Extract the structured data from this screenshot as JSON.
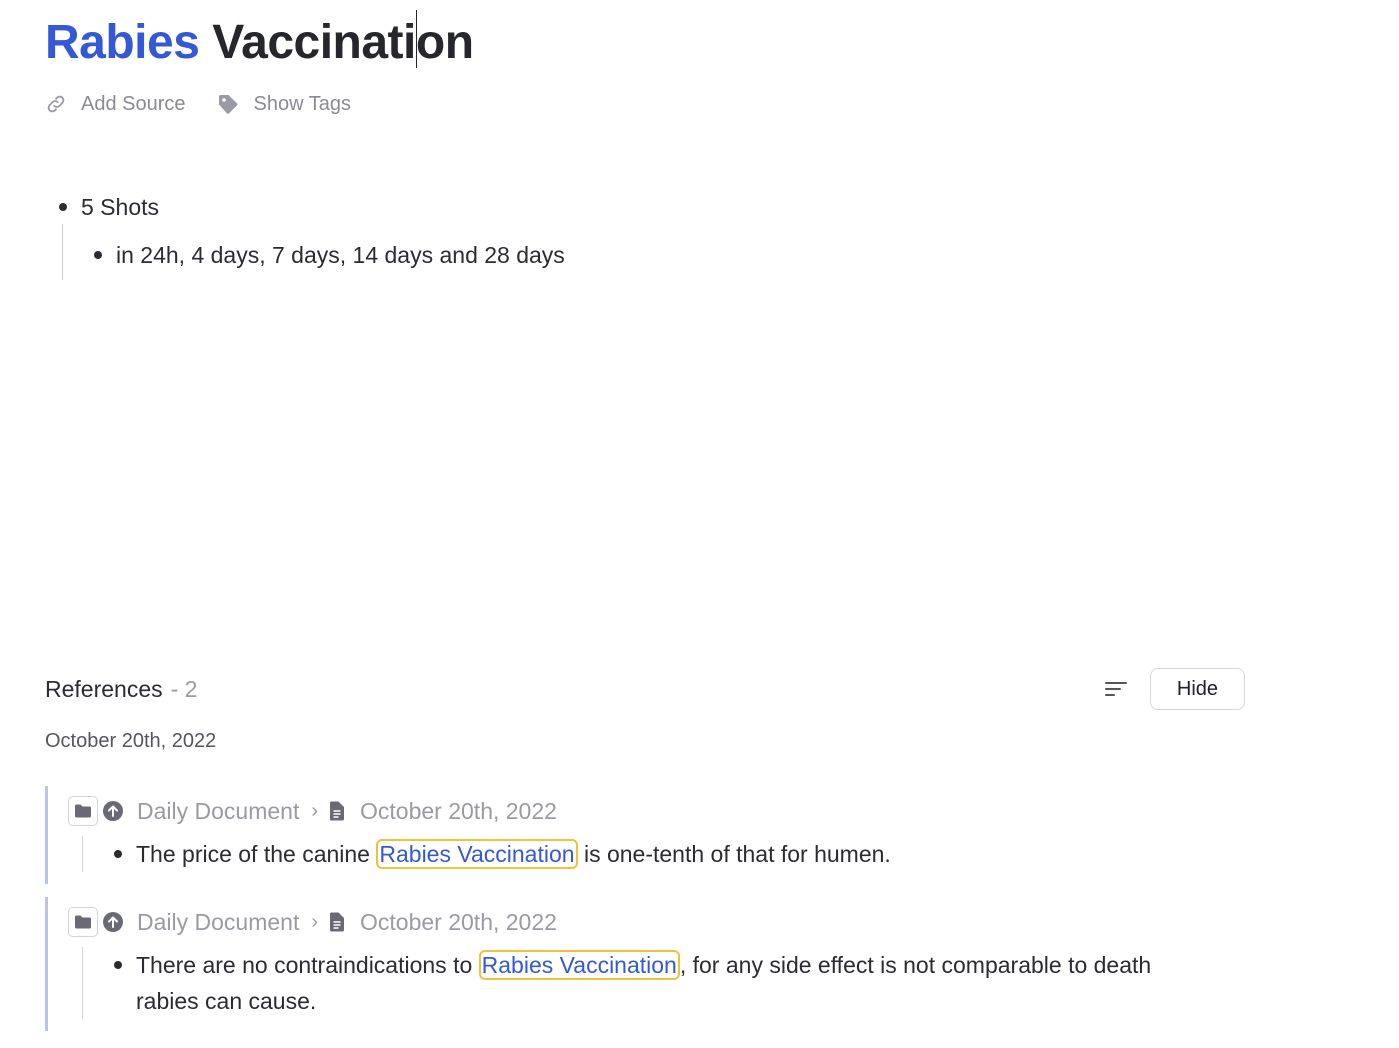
{
  "page": {
    "title_link": "Rabies",
    "title_rest": "Vaccinati",
    "title_rest_after_caret": "on"
  },
  "meta": {
    "add_source": {
      "label": "Add Source",
      "icon": "link-icon"
    },
    "show_tags": {
      "label": "Show Tags",
      "icon": "tag-icon"
    }
  },
  "content": {
    "bullet_1": "5 Shots",
    "bullet_1_child": "in 24h, 4 days, 7 days, 14 days and 28 days"
  },
  "references": {
    "title": "References",
    "count": "- 2",
    "hide_label": "Hide",
    "sort_icon": "sort-icon",
    "date_group": "October 20th, 2022",
    "items": [
      {
        "parent": "Daily Document",
        "separator": "›",
        "page": "October 20th, 2022",
        "text_before": "The price of the canine ",
        "link": "Rabies Vaccination",
        "text_after": " is one-tenth of that for humen."
      },
      {
        "parent": "Daily Document",
        "separator": "›",
        "page": "October 20th, 2022",
        "text_before": "There are no contraindications to ",
        "link": "Rabies Vaccination",
        "text_after": ", for any side effect is not comparable to death rabies can cause."
      }
    ]
  },
  "colors": {
    "accent": "#3558d6",
    "highlight_border": "#f0c13d",
    "ref_bar": "#b8c4ee",
    "muted": "#9a9aa5"
  }
}
